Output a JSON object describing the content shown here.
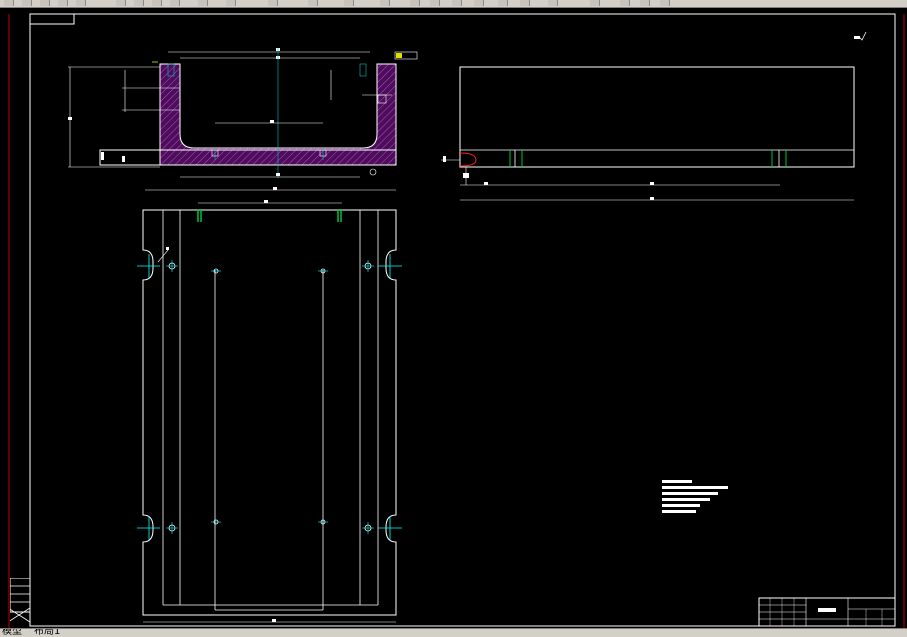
{
  "toolbar": {
    "buttons": [
      "new",
      "open",
      "save",
      "print",
      "undo",
      "redo",
      "layer",
      "properties",
      "match",
      "zoom",
      "pan",
      "realtime",
      "window",
      "previous",
      "distance",
      "area",
      "calc",
      "help"
    ]
  },
  "tabs": [
    {
      "label": "模型",
      "active": false
    },
    {
      "label": "布局1",
      "active": true
    }
  ],
  "colors": {
    "background": "#000000",
    "lines": "#ffffff",
    "hatch": "#a020c0",
    "centerline": "#00ffff",
    "frame_red": "#c00000",
    "green": "#00c040"
  },
  "icons": [
    "ucs-axis-icon"
  ]
}
